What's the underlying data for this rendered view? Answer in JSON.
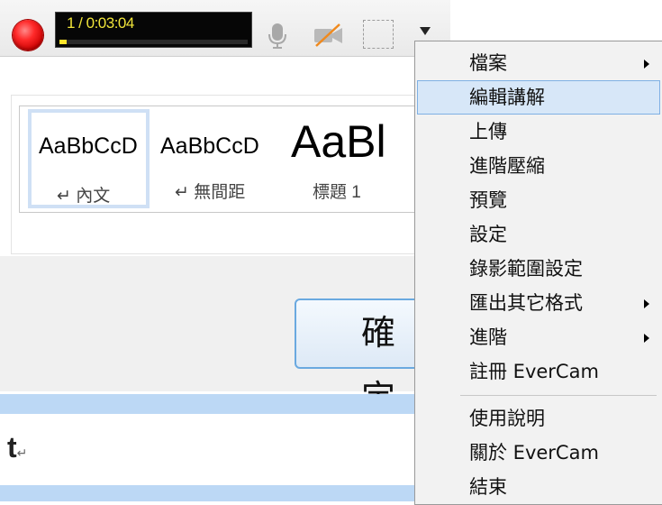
{
  "toolbar": {
    "timer_text": "1 / 0:03:04",
    "progress": 0.04,
    "icons": [
      "record-icon",
      "mic-icon",
      "camera-off-icon",
      "region-select-icon",
      "menu-dropdown-icon"
    ]
  },
  "background": {
    "styles": [
      {
        "sample": "AaBbCcD",
        "label": "↵ 內文"
      },
      {
        "sample": "AaBbCcD",
        "label": "↵ 無間距"
      },
      {
        "sample": "AaBl",
        "label": "標題 1"
      }
    ],
    "confirm_button_text": "確定",
    "doc_text": "t",
    "paragraph_mark": "↵"
  },
  "menu": {
    "items": [
      {
        "label": "檔案",
        "submenu": true
      },
      {
        "label": "編輯講解",
        "submenu": false,
        "highlighted": true
      },
      {
        "label": "上傳",
        "submenu": false
      },
      {
        "label": "進階壓縮",
        "submenu": false
      },
      {
        "label": "預覽",
        "submenu": false
      },
      {
        "label": "設定",
        "submenu": false
      },
      {
        "label": "錄影範圍設定",
        "submenu": false
      },
      {
        "label": "匯出其它格式",
        "submenu": true
      },
      {
        "label": "進階",
        "submenu": true
      },
      {
        "label": "註冊 EverCam",
        "submenu": false
      }
    ],
    "items2": [
      {
        "label": "使用說明"
      },
      {
        "label": "關於 EverCam"
      },
      {
        "label": "結束"
      }
    ]
  },
  "colors": {
    "highlight": "#d7e7f8",
    "record": "#ff2a2a",
    "timer_text": "#f1e53a"
  }
}
